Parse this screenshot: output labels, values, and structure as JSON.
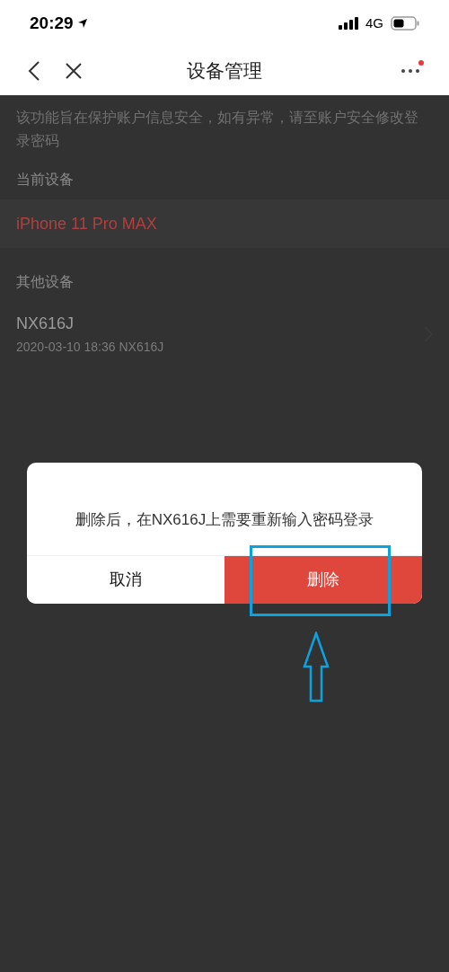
{
  "status_bar": {
    "time": "20:29",
    "network": "4G"
  },
  "nav": {
    "title": "设备管理",
    "notification_dot": true
  },
  "notice": "该功能旨在保护账户信息安全，如有异常，请至账户安全修改登录密码",
  "sections": [
    {
      "kind": "current",
      "label": "当前设备",
      "devices": [
        {
          "name": "iPhone 11 Pro MAX"
        }
      ]
    },
    {
      "kind": "other",
      "label": "其他设备",
      "devices": [
        {
          "name": "NX616J",
          "detail": "2020-03-10 18:36 NX616J"
        }
      ]
    }
  ],
  "dialog": {
    "message": "删除后，在NX616J上需要重新输入密码登录",
    "buttons": [
      {
        "label": "取消",
        "kind": "cancel"
      },
      {
        "label": "删除",
        "kind": "destructive"
      }
    ]
  }
}
